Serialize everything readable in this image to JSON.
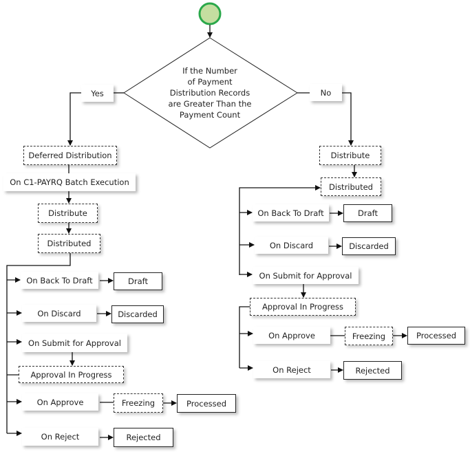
{
  "decision": {
    "lines": [
      "If the Number",
      "of Payment",
      "Distribution Records",
      "are Greater Than the",
      "Payment Count"
    ]
  },
  "colors": {
    "start_fill": "#c4dea0",
    "start_stroke": "#2aa84a",
    "line": "#111111"
  },
  "nodes": [
    {
      "id": "yes",
      "label": "Yes",
      "style": "label"
    },
    {
      "id": "no",
      "label": "No",
      "style": "label"
    },
    {
      "id": "l_deferred",
      "label": "Deferred Distribution",
      "style": "dashed"
    },
    {
      "id": "l_batch",
      "label": "On C1-PAYRQ Batch Execution",
      "style": "label"
    },
    {
      "id": "l_distribute",
      "label": "Distribute",
      "style": "dashed"
    },
    {
      "id": "l_distributed",
      "label": "Distributed",
      "style": "dashed"
    },
    {
      "id": "l_backdraft",
      "label": "On Back To Draft",
      "style": "label"
    },
    {
      "id": "l_draft",
      "label": "Draft",
      "style": "solid"
    },
    {
      "id": "l_ondiscard",
      "label": "On Discard",
      "style": "label"
    },
    {
      "id": "l_discarded",
      "label": "Discarded",
      "style": "solid"
    },
    {
      "id": "l_submit",
      "label": "On Submit for Approval",
      "style": "label"
    },
    {
      "id": "l_approval",
      "label": "Approval In Progress",
      "style": "dashed"
    },
    {
      "id": "l_onapprove",
      "label": "On Approve",
      "style": "label"
    },
    {
      "id": "l_freezing",
      "label": "Freezing",
      "style": "dashed"
    },
    {
      "id": "l_processed",
      "label": "Processed",
      "style": "solid"
    },
    {
      "id": "l_onreject",
      "label": "On Reject",
      "style": "label"
    },
    {
      "id": "l_rejected",
      "label": "Rejected",
      "style": "solid"
    },
    {
      "id": "r_distribute",
      "label": "Distribute",
      "style": "dashed"
    },
    {
      "id": "r_distributed",
      "label": "Distributed",
      "style": "dashed"
    },
    {
      "id": "r_backdraft",
      "label": "On Back To Draft",
      "style": "label"
    },
    {
      "id": "r_draft",
      "label": "Draft",
      "style": "solid"
    },
    {
      "id": "r_ondiscard",
      "label": "On Discard",
      "style": "label"
    },
    {
      "id": "r_discarded",
      "label": "Discarded",
      "style": "solid"
    },
    {
      "id": "r_submit",
      "label": "On Submit for Approval",
      "style": "label"
    },
    {
      "id": "r_approval",
      "label": "Approval In Progress",
      "style": "dashed"
    },
    {
      "id": "r_onapprove",
      "label": "On Approve",
      "style": "label"
    },
    {
      "id": "r_freezing",
      "label": "Freezing",
      "style": "dashed"
    },
    {
      "id": "r_processed",
      "label": "Processed",
      "style": "solid"
    },
    {
      "id": "r_onreject",
      "label": "On Reject",
      "style": "label"
    },
    {
      "id": "r_rejected",
      "label": "Rejected",
      "style": "solid"
    }
  ]
}
